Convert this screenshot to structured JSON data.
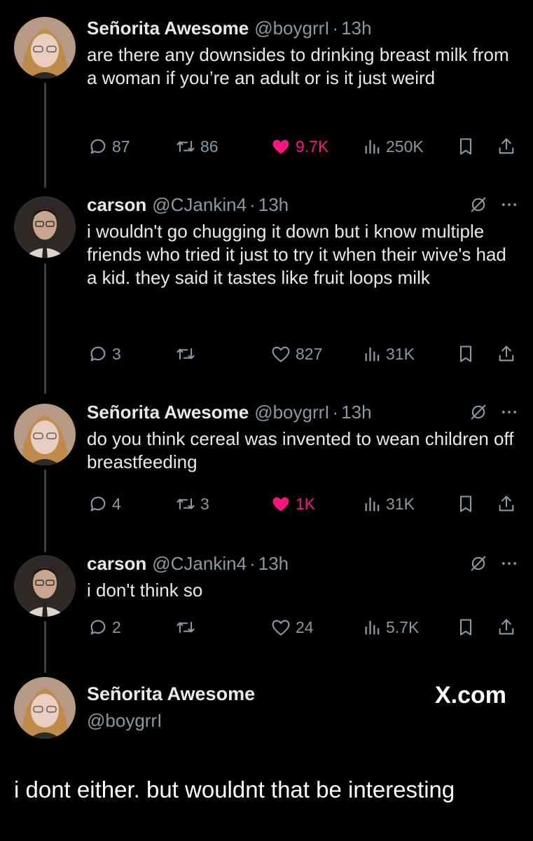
{
  "tweets": [
    {
      "name": "Señorita Awesome",
      "handle": "@boygrrI",
      "time": "13h",
      "text": "are there any downsides to drinking breast milk from a woman if you’re an adult or is it just weird",
      "replies": "87",
      "retweets": "86",
      "likes": "9.7K",
      "views": "250K",
      "liked": true
    },
    {
      "name": "carson",
      "handle": "@CJankin4",
      "time": "13h",
      "text": "i wouldn't go chugging it down but i know multiple friends who tried it just to try it when their wive's had a kid. they said it tastes like fruit loops milk",
      "replies": "3",
      "retweets": "",
      "likes": "827",
      "views": "31K",
      "liked": false
    },
    {
      "name": "Señorita Awesome",
      "handle": "@boygrrI",
      "time": "13h",
      "text": "do you think cereal was invented to wean children off breastfeeding",
      "replies": "4",
      "retweets": "3",
      "likes": "1K",
      "views": "31K",
      "liked": true
    },
    {
      "name": "carson",
      "handle": "@CJankin4",
      "time": "13h",
      "text": "i don't think so",
      "replies": "2",
      "retweets": "",
      "likes": "24",
      "views": "5.7K",
      "liked": false
    }
  ],
  "footer": {
    "name": "Señorita Awesome",
    "handle": "@boygrrI",
    "brand": "X.com",
    "text": "i dont either. but wouldnt that be interesting"
  },
  "separator": "·",
  "colors": {
    "like": "#f91880",
    "muted": "#8b98a5",
    "text": "#e7e9ea",
    "background": "#000000"
  }
}
